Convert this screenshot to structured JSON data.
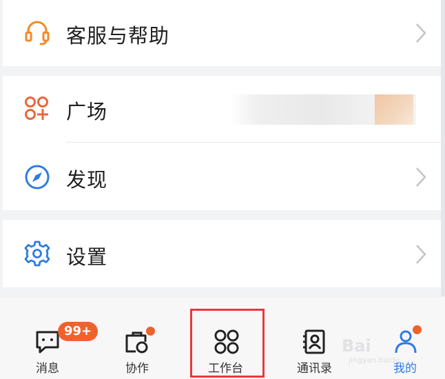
{
  "menu": {
    "support": {
      "label": "客服与帮助",
      "icon": "headset-icon"
    },
    "plaza": {
      "label": "广场",
      "icon": "apps-plus-icon"
    },
    "discover": {
      "label": "发现",
      "icon": "compass-icon"
    },
    "settings": {
      "label": "设置",
      "icon": "gear-icon"
    }
  },
  "tabbar": {
    "messages": {
      "label": "消息",
      "badge": "99+"
    },
    "collab": {
      "label": "协作"
    },
    "workbench": {
      "label": "工作台"
    },
    "contacts": {
      "label": "通讯录"
    },
    "me": {
      "label": "我的"
    }
  },
  "watermark": {
    "text": "Bai",
    "sub": "jingyan.baidu"
  },
  "colors": {
    "orange": "#f08a2a",
    "red_orange": "#e9663a",
    "blue": "#2f7be0",
    "badge": "#f0622d",
    "highlight": "#e8383d"
  }
}
